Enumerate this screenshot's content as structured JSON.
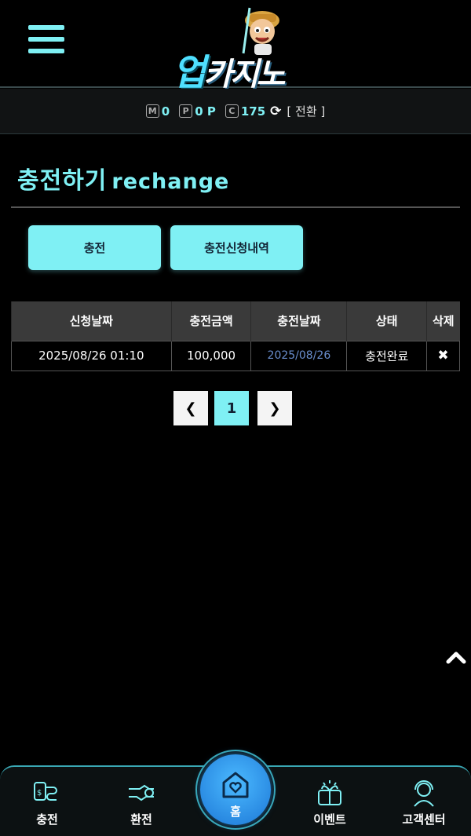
{
  "header": {
    "logo_part1": "업",
    "logo_part2": "카지노"
  },
  "balance": {
    "money_icon": "M",
    "money_value": "0",
    "point_icon": "P",
    "point_value": "0 P",
    "coin_icon": "C",
    "coin_value": "175",
    "switch_label": "[ 전환 ]"
  },
  "page": {
    "title_ko": "충전하기",
    "title_en": "rechange"
  },
  "tabs": [
    {
      "label": "충전"
    },
    {
      "label": "충전신청내역"
    }
  ],
  "table": {
    "headers": [
      "신청날짜",
      "충전금액",
      "충전날짜",
      "상태",
      "삭제"
    ],
    "rows": [
      {
        "request_date": "2025/08/26 01:10",
        "amount": "100,000",
        "charge_date": "2025/08/26",
        "status": "충전완료",
        "delete": "✖"
      }
    ]
  },
  "pagination": {
    "prev": "❮",
    "current": "1",
    "next": "❯"
  },
  "scroll_top": "⌃",
  "bottom_nav": {
    "charge": "충전",
    "exchange": "환전",
    "home": "홈",
    "event": "이벤트",
    "support": "고객센터"
  },
  "colors": {
    "accent": "#7ff0f4",
    "home_button": "#2a90ee",
    "background": "#000000"
  }
}
